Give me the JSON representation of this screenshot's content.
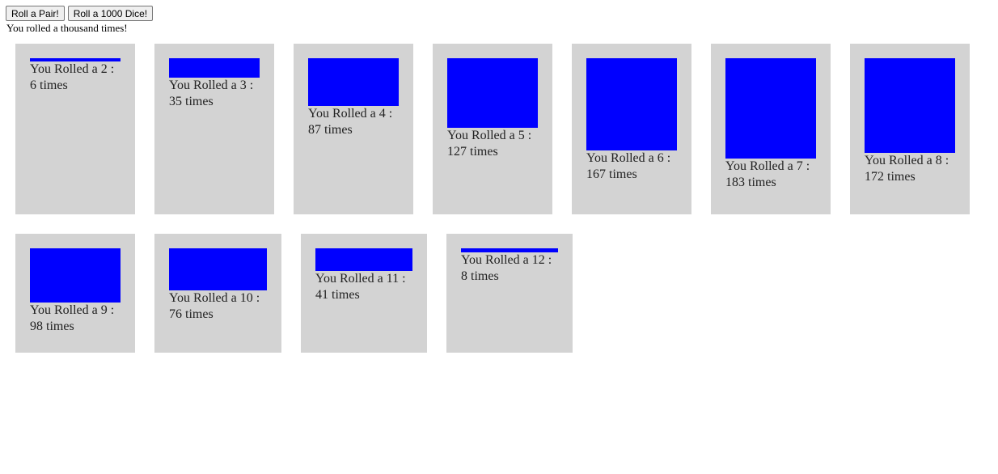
{
  "controls": {
    "roll_pair_label": "Roll a Pair!",
    "roll_1000_label": "Roll a 1000 Dice!"
  },
  "status_text": "You rolled a thousand times!",
  "bar_color": "#0000ff",
  "card_color": "#d3d3d3",
  "results": [
    {
      "sum": "2",
      "label": "You Rolled a 2 :",
      "count": 6,
      "count_text": "6 times"
    },
    {
      "sum": "3",
      "label": "You Rolled a 3 :",
      "count": 35,
      "count_text": "35 times"
    },
    {
      "sum": "4",
      "label": "You Rolled a 4 :",
      "count": 87,
      "count_text": "87 times"
    },
    {
      "sum": "5",
      "label": "You Rolled a 5 :",
      "count": 127,
      "count_text": "127 times"
    },
    {
      "sum": "6",
      "label": "You Rolled a 6 :",
      "count": 167,
      "count_text": "167 times"
    },
    {
      "sum": "7",
      "label": "You Rolled a 7 :",
      "count": 183,
      "count_text": "183 times"
    },
    {
      "sum": "8",
      "label": "You Rolled a 8 :",
      "count": 172,
      "count_text": "172 times"
    },
    {
      "sum": "9",
      "label": "You Rolled a 9 :",
      "count": 98,
      "count_text": "98 times"
    },
    {
      "sum": "10",
      "label": "You Rolled a 10 :",
      "count": 76,
      "count_text": "76 times"
    },
    {
      "sum": "11",
      "label": "You Rolled a 11 :",
      "count": 41,
      "count_text": "41 times"
    },
    {
      "sum": "12",
      "label": "You Rolled a 12 :",
      "count": 8,
      "count_text": "8 times"
    }
  ]
}
